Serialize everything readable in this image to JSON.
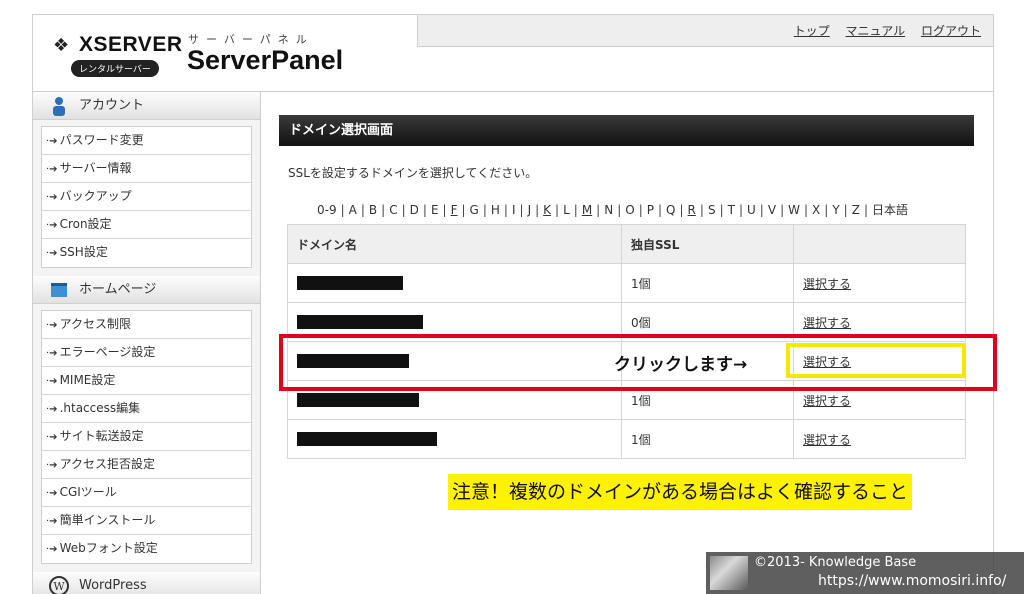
{
  "header": {
    "logo_text": "XSERVER",
    "logo_badge": "レンタルサーバー",
    "panel_kana": "サーバーパネル",
    "panel_title": "ServerPanel",
    "links": [
      "トップ",
      "マニュアル",
      "ログアウト"
    ]
  },
  "sidebar": {
    "sections": [
      {
        "title": "アカウント",
        "icon": "user-icon",
        "items": [
          "パスワード変更",
          "サーバー情報",
          "バックアップ",
          "Cron設定",
          "SSH設定"
        ]
      },
      {
        "title": "ホームページ",
        "icon": "monitor-icon",
        "items": [
          "アクセス制限",
          "エラーページ設定",
          "MIME設定",
          ".htaccess編集",
          "サイト転送設定",
          "アクセス拒否設定",
          "CGIツール",
          "簡単インストール",
          "Webフォント設定"
        ]
      },
      {
        "title": "WordPress",
        "icon": "wordpress-icon",
        "items": []
      }
    ]
  },
  "main": {
    "title": "ドメイン選択画面",
    "instruction": "SSLを設定するドメインを選択してください。",
    "alphabet": [
      {
        "t": "0-9",
        "link": false
      },
      {
        "t": "A",
        "link": false
      },
      {
        "t": "B",
        "link": false
      },
      {
        "t": "C",
        "link": false
      },
      {
        "t": "D",
        "link": false
      },
      {
        "t": "E",
        "link": false
      },
      {
        "t": "F",
        "link": true
      },
      {
        "t": "G",
        "link": false
      },
      {
        "t": "H",
        "link": false
      },
      {
        "t": "I",
        "link": false
      },
      {
        "t": "J",
        "link": false
      },
      {
        "t": "K",
        "link": true
      },
      {
        "t": "L",
        "link": false
      },
      {
        "t": "M",
        "link": true
      },
      {
        "t": "N",
        "link": false
      },
      {
        "t": "O",
        "link": false
      },
      {
        "t": "P",
        "link": false
      },
      {
        "t": "Q",
        "link": false
      },
      {
        "t": "R",
        "link": true
      },
      {
        "t": "S",
        "link": false
      },
      {
        "t": "T",
        "link": false
      },
      {
        "t": "U",
        "link": false
      },
      {
        "t": "V",
        "link": false
      },
      {
        "t": "W",
        "link": false
      },
      {
        "t": "X",
        "link": false
      },
      {
        "t": "Y",
        "link": false
      },
      {
        "t": "Z",
        "link": false
      },
      {
        "t": "日本語",
        "link": false
      }
    ],
    "table": {
      "headers": [
        "ドメイン名",
        "独自SSL",
        ""
      ],
      "rows": [
        {
          "ssl": "1個",
          "action": "選択する"
        },
        {
          "ssl": "0個",
          "action": "選択する"
        },
        {
          "ssl": "",
          "action": "選択する"
        },
        {
          "ssl": "1個",
          "action": "選択する"
        },
        {
          "ssl": "1個",
          "action": "選択する"
        }
      ]
    }
  },
  "annotations": {
    "click_label": "クリックします→",
    "note": "注意！複数のドメインがある場合はよく確認すること",
    "highlight_color": "#e0001c",
    "button_highlight_color": "#f5e800",
    "note_background": "#fff200"
  },
  "watermark": {
    "line1": "©2013- Knowledge Base",
    "line2": "https://www.momosiri.info/"
  }
}
